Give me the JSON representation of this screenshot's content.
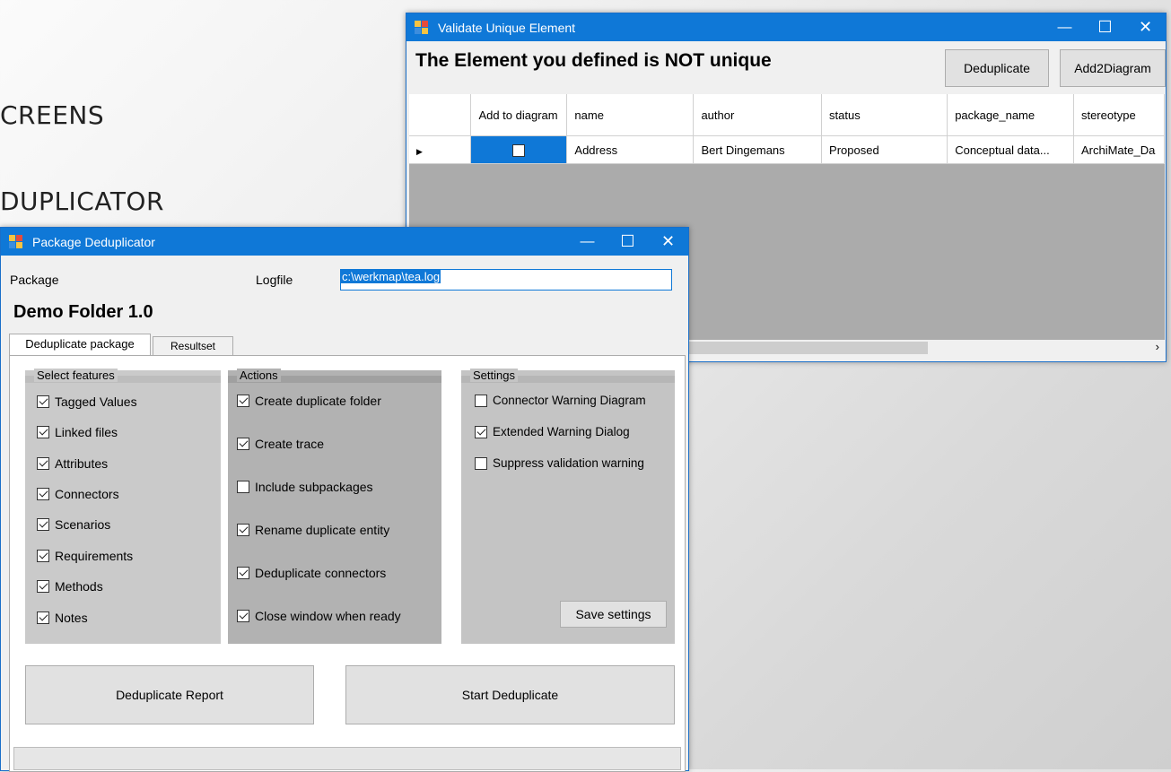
{
  "slide": {
    "line1": "CREENS",
    "line2": "DUPLICATOR"
  },
  "validate": {
    "title": "Validate Unique Element",
    "heading": "The Element you defined is NOT unique",
    "buttons": {
      "deduplicate": "Deduplicate",
      "add2diagram": "Add2Diagram"
    },
    "columns": [
      "Add to diagram",
      "name",
      "author",
      "status",
      "package_name",
      "stereotype"
    ],
    "rows": [
      {
        "add_to_diagram": false,
        "name": "Address",
        "author": "Bert Dingemans",
        "status": "Proposed",
        "package_name": "Conceptual data...",
        "stereotype": "ArchiMate_Da"
      }
    ]
  },
  "dedup": {
    "title": "Package Deduplicator",
    "package_label": "Package",
    "logfile_label": "Logfile",
    "logfile_value": "c:\\werkmap\\tea.log",
    "package_name": "Demo Folder 1.0",
    "tabs": [
      "Deduplicate package",
      "Resultset"
    ],
    "features": {
      "label": "Select features",
      "items": [
        {
          "label": "Tagged Values",
          "checked": true
        },
        {
          "label": "Linked files",
          "checked": true
        },
        {
          "label": "Attributes",
          "checked": true
        },
        {
          "label": "Connectors",
          "checked": true
        },
        {
          "label": "Scenarios",
          "checked": true
        },
        {
          "label": "Requirements",
          "checked": true
        },
        {
          "label": "Methods",
          "checked": true
        },
        {
          "label": "Notes",
          "checked": true
        }
      ]
    },
    "actions": {
      "label": "Actions",
      "items": [
        {
          "label": "Create duplicate folder",
          "checked": true
        },
        {
          "label": "Create trace",
          "checked": true
        },
        {
          "label": "Include subpackages",
          "checked": false
        },
        {
          "label": "Rename duplicate entity",
          "checked": true
        },
        {
          "label": "Deduplicate connectors",
          "checked": true
        },
        {
          "label": "Close window when ready",
          "checked": true
        }
      ]
    },
    "settings": {
      "label": "Settings",
      "items": [
        {
          "label": "Connector Warning Diagram",
          "checked": false
        },
        {
          "label": "Extended Warning Dialog",
          "checked": true
        },
        {
          "label": "Suppress validation warning",
          "checked": false
        }
      ],
      "save_label": "Save settings"
    },
    "report_button": "Deduplicate Report",
    "start_button": "Start Deduplicate"
  }
}
